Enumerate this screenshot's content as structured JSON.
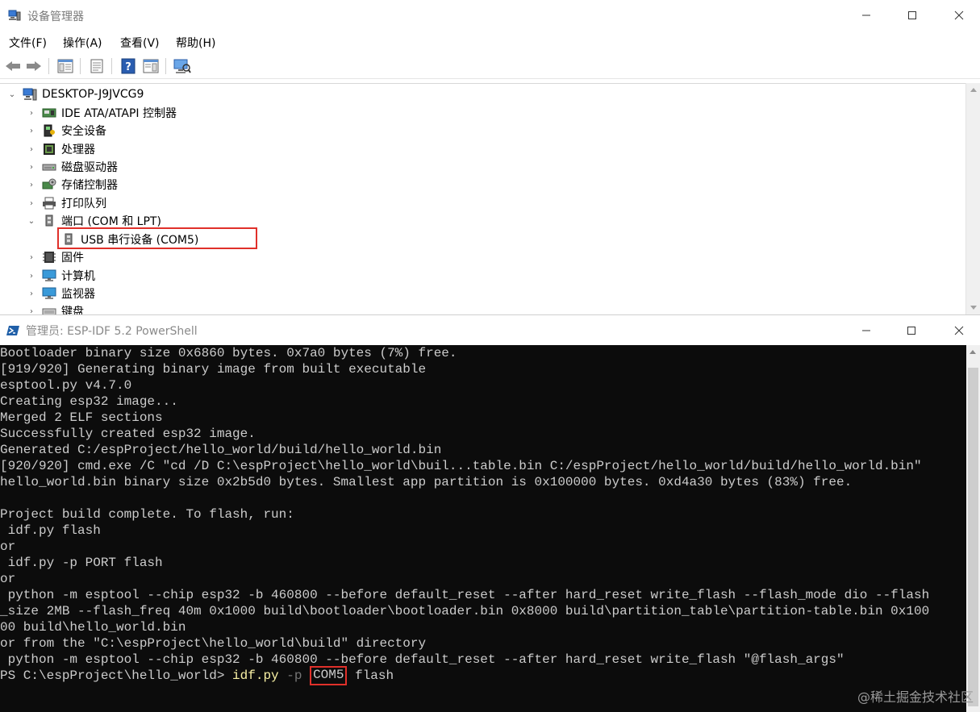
{
  "device_manager": {
    "title": "设备管理器",
    "menus": [
      "文件(F)",
      "操作(A)",
      "查看(V)",
      "帮助(H)"
    ],
    "root": "DESKTOP-J9JVCG9",
    "nodes": [
      {
        "label": "IDE ATA/ATAPI 控制器",
        "icon": "ide-controller-icon"
      },
      {
        "label": "安全设备",
        "icon": "security-device-icon"
      },
      {
        "label": "处理器",
        "icon": "processor-icon"
      },
      {
        "label": "磁盘驱动器",
        "icon": "disk-drive-icon"
      },
      {
        "label": "存储控制器",
        "icon": "storage-controller-icon"
      },
      {
        "label": "打印队列",
        "icon": "printer-icon"
      },
      {
        "label": "端口 (COM 和 LPT)",
        "icon": "port-icon"
      },
      {
        "label": "USB 串行设备 (COM5)",
        "icon": "usb-serial-icon"
      },
      {
        "label": "固件",
        "icon": "firmware-icon"
      },
      {
        "label": "计算机",
        "icon": "computer-icon"
      },
      {
        "label": "监视器",
        "icon": "monitor-icon"
      },
      {
        "label": "键盘",
        "icon": "keyboard-icon"
      }
    ]
  },
  "powershell": {
    "title": "管理员: ESP-IDF 5.2 PowerShell",
    "lines": [
      "Bootloader binary size 0x6860 bytes. 0x7a0 bytes (7%) free.",
      "[919/920] Generating binary image from built executable",
      "esptool.py v4.7.0",
      "Creating esp32 image...",
      "Merged 2 ELF sections",
      "Successfully created esp32 image.",
      "Generated C:/espProject/hello_world/build/hello_world.bin",
      "[920/920] cmd.exe /C \"cd /D C:\\espProject\\hello_world\\buil...table.bin C:/espProject/hello_world/build/hello_world.bin\"",
      "hello_world.bin binary size 0x2b5d0 bytes. Smallest app partition is 0x100000 bytes. 0xd4a30 bytes (83%) free.",
      "",
      "Project build complete. To flash, run:",
      " idf.py flash",
      "or",
      " idf.py -p PORT flash",
      "or",
      " python -m esptool --chip esp32 -b 460800 --before default_reset --after hard_reset write_flash --flash_mode dio --flash",
      "_size 2MB --flash_freq 40m 0x1000 build\\bootloader\\bootloader.bin 0x8000 build\\partition_table\\partition-table.bin 0x100",
      "00 build\\hello_world.bin",
      "or from the \"C:\\espProject\\hello_world\\build\" directory",
      " python -m esptool --chip esp32 -b 460800 --before default_reset --after hard_reset write_flash \"@flash_args\""
    ],
    "prompt": "PS C:\\espProject\\hello_world> ",
    "cmd": "idf.py",
    "arg_flag": "-p",
    "arg_port": "COM5",
    "arg_rest": "flash"
  },
  "watermark": "@稀土掘金技术社区",
  "colors": {
    "highlight": "#e0302a",
    "console_bg": "#0c0c0c",
    "console_fg": "#cccccc",
    "command": "#f9f1a5"
  }
}
